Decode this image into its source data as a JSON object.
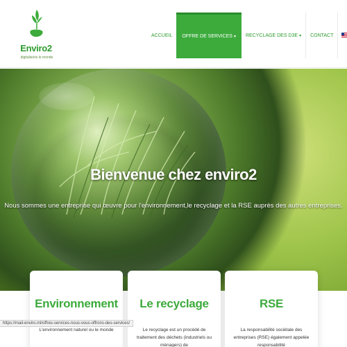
{
  "brand": {
    "name": "Enviro2",
    "tagline": "digitalisons le monde",
    "accent_color": "#3cab3c"
  },
  "nav": {
    "items": [
      {
        "label": "ACCUEIL",
        "active": false
      },
      {
        "label": "OFFRE DE SERVICES",
        "active": true,
        "has_dropdown": true
      },
      {
        "label": "RECYCLAGE DES D3E",
        "active": false,
        "has_dropdown": true
      },
      {
        "label": "CONTACT",
        "active": false
      }
    ],
    "languages": [
      {
        "icon": "flag-en-icon"
      },
      {
        "icon": "flag-fr-icon"
      }
    ]
  },
  "hero": {
    "title": "Bienvenue chez enviro2",
    "subtitle": "Nous sommes une entreprise qui œuvre pour l'environnement,le recyclage et la RSE auprès des autres entreprises."
  },
  "cards": [
    {
      "title": "Environnement",
      "text": "L'environnement naturel ou le monde"
    },
    {
      "title": "Le recyclage",
      "text": "Le recyclage est un procédé de traitement des déchets (industriels ou ménagers) de"
    },
    {
      "title": "RSE",
      "text": "La responsabilité sociétale des entreprises (RSE) également appelée responsabilité"
    }
  ],
  "status_bar": {
    "url": "https://mail-enviro.ml/offres-services-nous-vous-offrons-des-services/"
  }
}
